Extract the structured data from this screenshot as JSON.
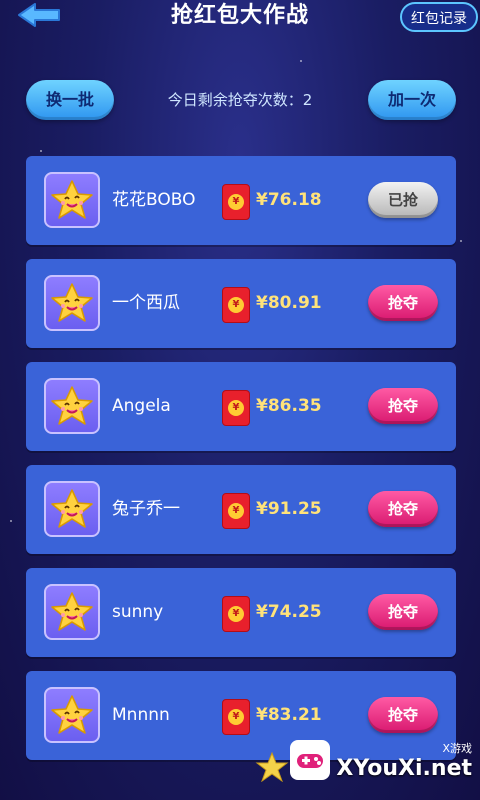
{
  "header": {
    "title": "抢红包大作战",
    "record_label": "红包记录"
  },
  "actions": {
    "refresh_label": "换一批",
    "remaining_text": "今日剩余抢夺次数：2",
    "add_label": "加一次"
  },
  "rows": [
    {
      "name": "花花BOBO",
      "amount": "¥76.18",
      "button": "已抢",
      "state": "done"
    },
    {
      "name": "一个西瓜",
      "amount": "¥80.91",
      "button": "抢夺",
      "state": "available"
    },
    {
      "name": "Angela",
      "amount": "¥86.35",
      "button": "抢夺",
      "state": "available"
    },
    {
      "name": "兔子乔一",
      "amount": "¥91.25",
      "button": "抢夺",
      "state": "available"
    },
    {
      "name": "sunny",
      "amount": "¥74.25",
      "button": "抢夺",
      "state": "available"
    },
    {
      "name": "Mnnnn",
      "amount": "¥83.21",
      "button": "抢夺",
      "state": "available"
    }
  ],
  "envelope_symbol": "¥",
  "watermark": {
    "small": "X游戏",
    "big": "XYouXi.net"
  },
  "colors": {
    "background": "#1a1d63",
    "row": "#3a63d8",
    "grab": "#e0217a",
    "amount": "#ffe27a"
  }
}
